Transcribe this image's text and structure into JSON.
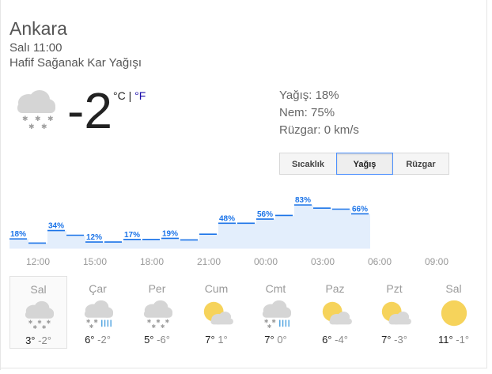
{
  "location": {
    "city": "Ankara",
    "time": "Salı 11:00",
    "condition": "Hafif Sağanak Kar Yağışı"
  },
  "current": {
    "temperature": "-2",
    "unit_c": "°C",
    "separator": " | ",
    "unit_f": "°F",
    "icon": "snow-cloud-icon"
  },
  "details": {
    "precip": "Yağış: 18%",
    "humidity": "Nem: 75%",
    "wind": "Rüzgar: 0 km/s"
  },
  "tabs": [
    {
      "label": "Sıcaklık",
      "selected": false
    },
    {
      "label": "Yağış",
      "selected": true
    },
    {
      "label": "Rüzgar",
      "selected": false
    }
  ],
  "chart_data": {
    "type": "area",
    "title": "",
    "xlabel": "",
    "ylabel": "",
    "ylim": [
      0,
      100
    ],
    "series": [
      {
        "values": [
          18,
          10,
          34,
          25,
          12,
          12,
          17,
          17,
          19,
          16,
          27,
          48,
          48,
          56,
          63,
          83,
          77,
          75,
          66
        ],
        "labels": [
          "18%",
          "",
          "34%",
          "",
          "12%",
          "",
          "17%",
          "",
          "19%",
          "",
          "",
          "48%",
          "",
          "56%",
          "",
          "83%",
          "",
          "",
          "66%"
        ]
      }
    ],
    "x_ticks": [
      "12:00",
      "15:00",
      "18:00",
      "21:00",
      "00:00",
      "03:00",
      "06:00",
      "09:00"
    ],
    "colors": {
      "line": "#1a73e8",
      "fill": "#e3eefc",
      "label": "#1a73e8"
    }
  },
  "forecast": [
    {
      "day": "Sal",
      "icon": "snow-cloud-icon",
      "high": "3°",
      "low": "-2°",
      "selected": true
    },
    {
      "day": "Çar",
      "icon": "snow-rain-cloud-icon",
      "high": "6°",
      "low": "-2°",
      "selected": false
    },
    {
      "day": "Per",
      "icon": "snow-cloud-icon",
      "high": "5°",
      "low": "-6°",
      "selected": false
    },
    {
      "day": "Cum",
      "icon": "partly-cloudy-icon",
      "high": "7°",
      "low": "1°",
      "selected": false
    },
    {
      "day": "Cmt",
      "icon": "snow-rain-cloud-icon",
      "high": "7°",
      "low": "0°",
      "selected": false
    },
    {
      "day": "Paz",
      "icon": "partly-cloudy-icon",
      "high": "6°",
      "low": "-4°",
      "selected": false
    },
    {
      "day": "Pzt",
      "icon": "partly-cloudy-icon",
      "high": "7°",
      "low": "-3°",
      "selected": false
    },
    {
      "day": "Sal",
      "icon": "sun-icon",
      "high": "11°",
      "low": "-1°",
      "selected": false
    }
  ]
}
